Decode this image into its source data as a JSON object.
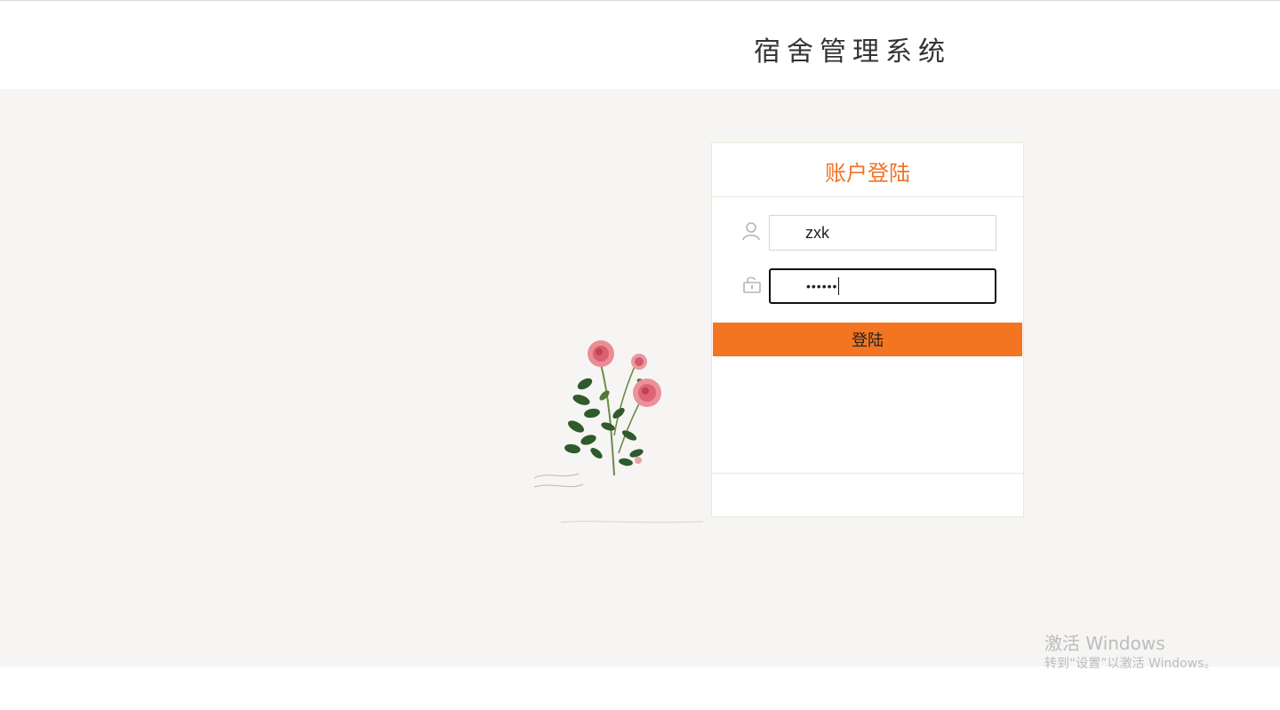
{
  "header": {
    "title": "宿舍管理系统"
  },
  "login": {
    "title": "账户登陆",
    "username": {
      "value": "zxk"
    },
    "password": {
      "masked_value": "••••••"
    },
    "submit_label": "登陆"
  },
  "watermark": {
    "line1": "激活 Windows",
    "line2": "转到“设置”以激活 Windows。"
  },
  "colors": {
    "accent": "#f47521",
    "title_accent": "#f07326",
    "page_bg": "#f6f5f3"
  },
  "icons": [
    "user-icon",
    "lock-icon",
    "rose-illustration"
  ]
}
